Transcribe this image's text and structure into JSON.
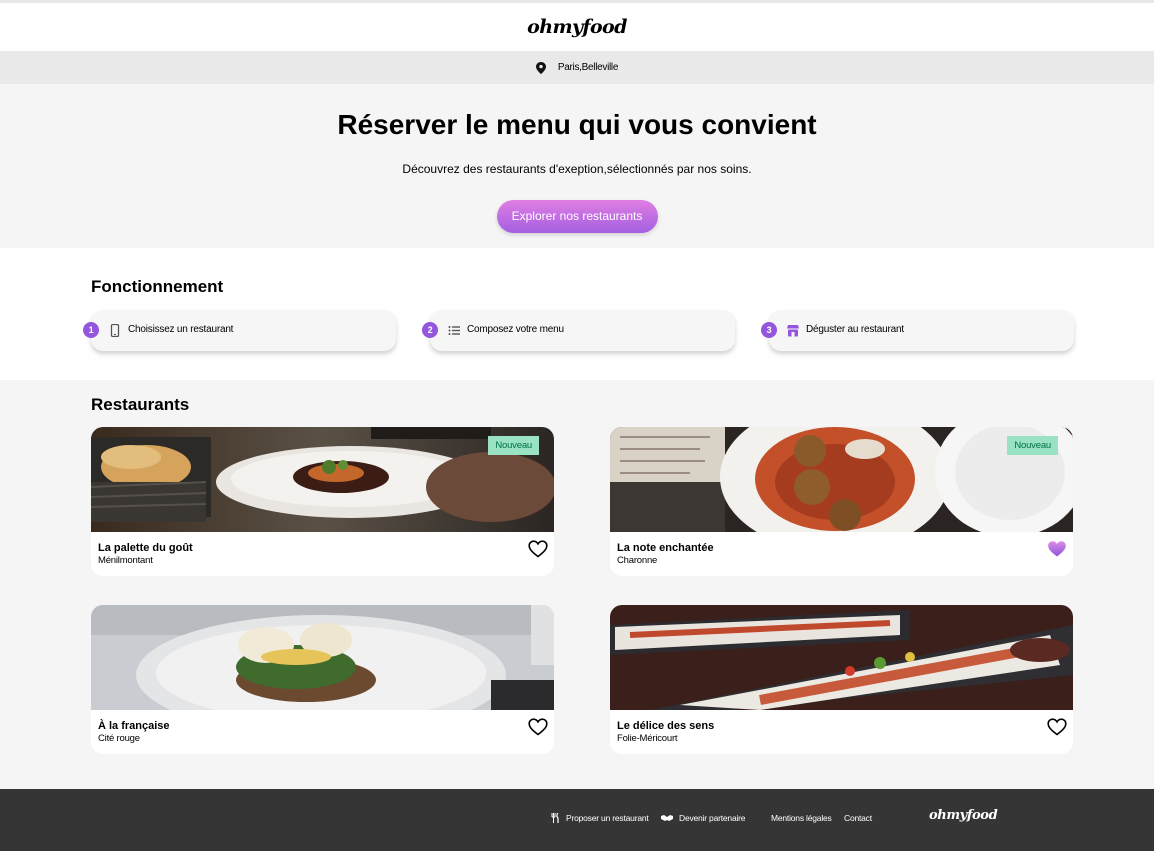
{
  "header": {
    "logo": "ohmyfood"
  },
  "location": {
    "text": "Paris,Belleville",
    "icon": "map-pin-icon"
  },
  "hero": {
    "title": "Réserver le menu qui vous convient",
    "subtitle": "Découvrez des restaurants d'exeption,sélectionnés par nos soins.",
    "cta_label": "Explorer nos restaurants"
  },
  "how": {
    "title": "Fonctionnement",
    "steps": [
      {
        "number": "1",
        "label": "Choisissez un restaurant",
        "icon": "phone-icon"
      },
      {
        "number": "2",
        "label": "Composez votre menu",
        "icon": "list-icon"
      },
      {
        "number": "3",
        "label": "Déguster au restaurant",
        "icon": "store-icon"
      }
    ]
  },
  "restaurants": {
    "title": "Restaurants",
    "items": [
      {
        "name": "La palette du goût",
        "area": "Ménilmontant",
        "badge": "Nouveau",
        "liked": false
      },
      {
        "name": "La note enchantée",
        "area": "Charonne",
        "badge": "Nouveau",
        "liked": true
      },
      {
        "name": "À la française",
        "area": "Cité rouge",
        "badge": "",
        "liked": false
      },
      {
        "name": "Le délice des sens",
        "area": "Folie-Méricourt",
        "badge": "",
        "liked": false
      }
    ]
  },
  "footer": {
    "links": [
      "Proposer un restaurant",
      "Devenir partenaire",
      "Mentions légales",
      "Contact"
    ],
    "logo": "ohmyfood"
  },
  "colors": {
    "accent": "#9356dc",
    "badge_bg": "#99e2c4",
    "badge_text": "#00704a",
    "footer_bg": "#353535"
  }
}
